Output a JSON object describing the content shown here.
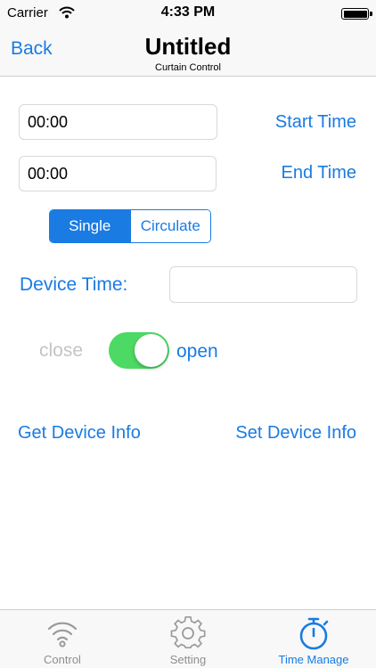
{
  "status_bar": {
    "carrier": "Carrier",
    "time": "4:33 PM"
  },
  "nav": {
    "back_label": "Back",
    "title": "Untitled",
    "subtitle": "Curtain Control"
  },
  "start_time": {
    "value": "00:00",
    "label": "Start Time"
  },
  "end_time": {
    "value": "00:00",
    "label": "End Time"
  },
  "mode": {
    "options": [
      "Single",
      "Circulate"
    ],
    "selected": "Single"
  },
  "device_time": {
    "label": "Device Time:",
    "value": ""
  },
  "switch": {
    "off_label": "close",
    "on_label": "open",
    "state": "on"
  },
  "actions": {
    "get_info": "Get Device Info",
    "set_info": "Set Device Info"
  },
  "tabs": [
    {
      "label": "Control",
      "icon": "wifi-icon"
    },
    {
      "label": "Setting",
      "icon": "gear-icon"
    },
    {
      "label": "Time Manage",
      "icon": "stopwatch-icon",
      "active": true
    }
  ],
  "colors": {
    "accent": "#1a7be2",
    "switch_on": "#4cd964",
    "inactive": "#8e8e8e"
  }
}
